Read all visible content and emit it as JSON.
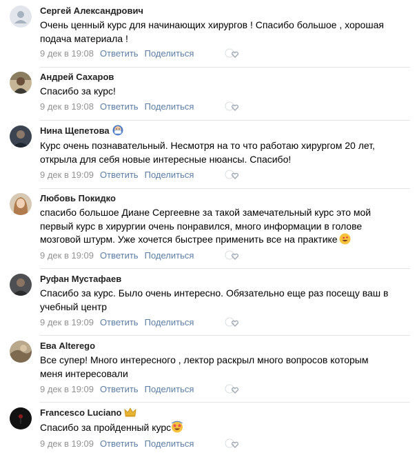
{
  "comments": [
    {
      "author": "Сергей Александрович",
      "avatar": "default-avatar-icon",
      "badge": "",
      "lines": [
        "Очень ценный курс для начинающих хирургов ! Спасибо большое , хорошая",
        "подача материала !"
      ],
      "date": "9 дек в 19:08",
      "reply": "Ответить",
      "share": "Поделиться"
    },
    {
      "author": "Андрей Сахаров",
      "avatar": "user-photo",
      "badge": "",
      "lines": [
        "Спасибо за курс!"
      ],
      "date": "9 дек в 19:08",
      "reply": "Ответить",
      "share": "Поделиться"
    },
    {
      "author": "Нина Щепетова",
      "avatar": "user-photo",
      "badge": "medical-mask-icon",
      "lines": [
        "Курс очень познавательный. Несмотря на то что работаю хирургом 20 лет,",
        "открыла для себя новые интересные нюансы. Спасибо!"
      ],
      "date": "9 дек в 19:09",
      "reply": "Ответить",
      "share": "Поделиться"
    },
    {
      "author": "Любовь Покидко",
      "avatar": "user-photo",
      "badge": "",
      "lines": [
        "спасибо большое Диане Сергеевне за такой замечательный курс это мой",
        "первый курс в хирургии очень понравился, много информации в голове",
        "мозговой штурм. Уже хочется быстрее применить все на практике"
      ],
      "emoji": "heart-eyes-emoji",
      "date": "9 дек в 19:09",
      "reply": "Ответить",
      "share": "Поделиться"
    },
    {
      "author": "Руфан Мустафаев",
      "avatar": "user-photo",
      "badge": "",
      "lines": [
        "Спасибо за курс. Было очень интересно. Обязательно еще раз посещу ваш в",
        "учебный центр"
      ],
      "date": "9 дек в 19:09",
      "reply": "Ответить",
      "share": "Поделиться"
    },
    {
      "author": "Ева Alterego",
      "avatar": "user-photo",
      "badge": "",
      "lines": [
        "Все супер! Много интересного , лектор раскрыл много вопросов которым",
        "меня интересовали"
      ],
      "date": "9 дек в 19:09",
      "reply": "Ответить",
      "share": "Поделиться"
    },
    {
      "author": "Francesco Luciano",
      "avatar": "user-photo",
      "badge": "crown-icon",
      "lines": [
        "Спасибо за пройденный курс"
      ],
      "emoji": "star-struck-emoji",
      "date": "9 дек в 19:09",
      "reply": "Ответить",
      "share": "Поделиться"
    }
  ],
  "like_icon": "like-heart-icon",
  "colors": {
    "link": "#5c7ea5",
    "meta": "#939393",
    "separator": "#e3e4e8"
  }
}
